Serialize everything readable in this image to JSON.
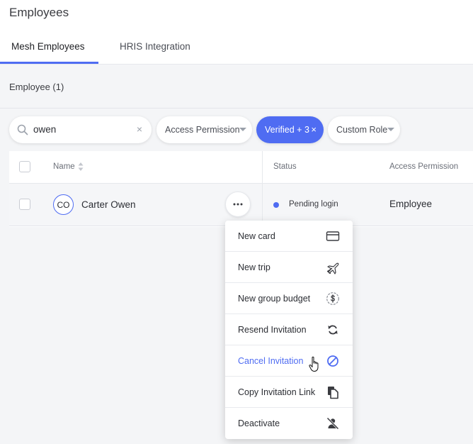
{
  "header": {
    "title": "Employees"
  },
  "tabs": [
    {
      "label": "Mesh Employees",
      "active": true
    },
    {
      "label": "HRIS Integration",
      "active": false
    }
  ],
  "employee_count_label": "Employee (1)",
  "filters": {
    "search": {
      "value": "owen",
      "clear_icon": "×"
    },
    "access_permission": "Access Permission",
    "status": "Verified + 3",
    "status_clear": "×",
    "custom_role": "Custom Role"
  },
  "table": {
    "columns": [
      "Name",
      "Status",
      "Access Permission"
    ],
    "rows": [
      {
        "initials": "CO",
        "name": "Carter Owen",
        "status": "Pending login",
        "access_permission": "Employee"
      }
    ]
  },
  "action_menu": {
    "items": [
      {
        "label": "New card",
        "icon": "credit-card-icon"
      },
      {
        "label": "New trip",
        "icon": "airplane-icon"
      },
      {
        "label": "New group budget",
        "icon": "dollar-coin-icon"
      },
      {
        "label": "Resend Invitation",
        "icon": "refresh-icon"
      },
      {
        "label": "Cancel Invitation",
        "icon": "cancel-icon",
        "highlighted": true
      },
      {
        "label": "Copy Invitation Link",
        "icon": "copy-icon"
      },
      {
        "label": "Deactivate",
        "icon": "user-off-icon"
      }
    ]
  },
  "colors": {
    "accent": "#4f6cf2",
    "background": "#f4f5f7"
  }
}
